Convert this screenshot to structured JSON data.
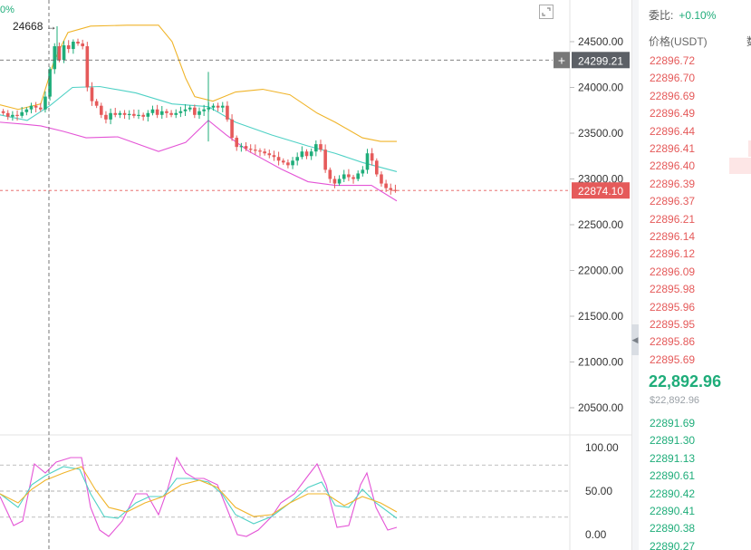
{
  "chart": {
    "top_left_pct": "0%",
    "crosshair_label": "24668 →",
    "price_ticks": [
      "24500.00",
      "24000.00",
      "23500.00",
      "23000.00",
      "22500.00",
      "22000.00",
      "21500.00",
      "21000.00",
      "20500.00"
    ],
    "hover_price_tag": "24299.21",
    "current_price_tag": "22874.10",
    "indicator_ticks": [
      "100.00",
      "50.00",
      "0.00"
    ],
    "colors": {
      "up": "#1fad7a",
      "down": "#e55a5a",
      "upper_band": "#f0b429",
      "middle_band": "#4fd1c5",
      "lower_band": "#e454d6",
      "k_line": "#e454d6",
      "d_line": "#4fd1c5",
      "j_line": "#f0b429"
    }
  },
  "orderbook": {
    "ratio_label": "委比:",
    "ratio_value": "+0.10%",
    "price_header": "价格(USDT)",
    "amount_header_cut": "数",
    "asks": [
      "22896.72",
      "22896.70",
      "22896.69",
      "22896.49",
      "22896.44",
      "22896.41",
      "22896.40",
      "22896.39",
      "22896.37",
      "22896.21",
      "22896.14",
      "22896.12",
      "22896.09",
      "22895.98",
      "22895.96",
      "22895.95",
      "22895.86",
      "22895.69"
    ],
    "last_price": "22,892.96",
    "last_price_usd": "$22,892.96",
    "bids": [
      "22891.69",
      "22891.30",
      "22891.13",
      "22890.61",
      "22890.42",
      "22890.41",
      "22890.38",
      "22890.27"
    ]
  }
}
